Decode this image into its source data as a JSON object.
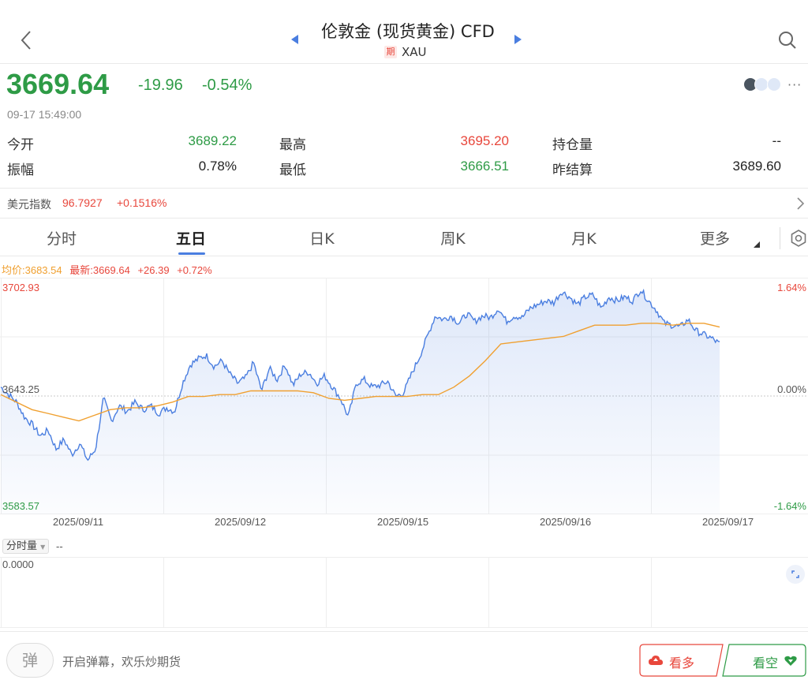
{
  "header": {
    "title": "伦敦金 (现货黄金) CFD",
    "badge": "期",
    "symbol": "XAU"
  },
  "quote": {
    "price": "3669.64",
    "change": "-19.96",
    "change_pct": "-0.54%",
    "datetime": "09-17 15:49:00"
  },
  "stats": {
    "open_label": "今开",
    "open_value": "3689.22",
    "high_label": "最高",
    "high_value": "3695.20",
    "oi_label": "持仓量",
    "oi_value": "--",
    "amp_label": "振幅",
    "amp_value": "0.78%",
    "low_label": "最低",
    "low_value": "3666.51",
    "settle_label": "昨结算",
    "settle_value": "3689.60"
  },
  "index_bar": {
    "label": "美元指数",
    "value": "96.7927",
    "change": "+0.1516%"
  },
  "tabs": [
    "分时",
    "五日",
    "日K",
    "周K",
    "月K",
    "更多"
  ],
  "chart_info": {
    "avg": "均价:3683.54",
    "latest": "最新:3669.64",
    "chg": "+26.39",
    "chg_pct": "+0.72%",
    "y_top": "3702.93",
    "y_mid": "3643.25",
    "y_bot": "3583.57",
    "pct_top": "1.64%",
    "pct_mid": "0.00%",
    "pct_bot": "-1.64%",
    "dates": [
      "2025/09/11",
      "2025/09/12",
      "2025/09/15",
      "2025/09/16",
      "2025/09/17"
    ]
  },
  "volume": {
    "selector": "分时量",
    "value": "--",
    "axis": "0.0000"
  },
  "footer": {
    "danmaku_icon": "弹",
    "danmaku_text": "开启弹幕，欢乐炒期货",
    "bull": "看多",
    "bear": "看空"
  },
  "colors": {
    "up": "#e8473c",
    "down": "#2e9b46",
    "line": "#4a7ee0",
    "avg": "#f0a030",
    "accent": "#4a7ee0"
  },
  "chart_data": {
    "type": "line",
    "x": [
      "2025/09/11",
      "2025/09/12",
      "2025/09/15",
      "2025/09/16",
      "2025/09/17"
    ],
    "ylim": [
      3583.57,
      3702.93
    ],
    "series": [
      {
        "values": [
          3648,
          3644,
          3640,
          3632,
          3628,
          3622,
          3625,
          3615,
          3620,
          3612,
          3618,
          3609,
          3615,
          3642,
          3630,
          3638,
          3635,
          3640,
          3636,
          3638,
          3634,
          3637,
          3635,
          3650,
          3660,
          3663,
          3665,
          3659,
          3662,
          3655,
          3650,
          3653,
          3661,
          3646,
          3658,
          3652,
          3660,
          3649,
          3655,
          3656,
          3650,
          3654,
          3648,
          3642,
          3632,
          3650,
          3652,
          3648,
          3649,
          3651,
          3643,
          3645,
          3655,
          3664,
          3675,
          3686,
          3684,
          3686,
          3682,
          3687,
          3683,
          3686,
          3685,
          3690,
          3683,
          3686,
          3685,
          3690,
          3692,
          3694,
          3693,
          3699,
          3696,
          3692,
          3696,
          3697,
          3690,
          3696,
          3694,
          3696,
          3694,
          3700,
          3694,
          3689,
          3682,
          3681,
          3680,
          3684,
          3678,
          3676,
          3674,
          3671
        ]
      },
      {
        "values": [
          3644,
          3640,
          3636,
          3634,
          3632,
          3630,
          3633,
          3636,
          3637,
          3637,
          3638,
          3640,
          3643,
          3643,
          3644,
          3644,
          3646,
          3646,
          3646,
          3646,
          3645,
          3642,
          3641,
          3642,
          3643,
          3643,
          3643,
          3644,
          3644,
          3648,
          3654,
          3662,
          3671,
          3672,
          3673,
          3674,
          3675,
          3678,
          3681,
          3681,
          3681,
          3682,
          3682,
          3681,
          3682,
          3682,
          3680
        ]
      }
    ]
  }
}
